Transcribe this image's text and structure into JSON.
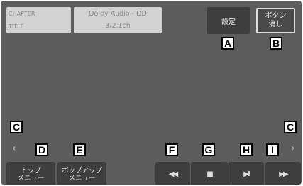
{
  "info": {
    "chapter_label": "CHAPTER",
    "title_label": "TITLE",
    "audio_format": "Dolby Audio - DD",
    "channels": "3/2.1ch"
  },
  "buttons": {
    "settings": "設定",
    "clear_line1": "ボタン",
    "clear_line2": "消し",
    "top_menu_line1": "トップ",
    "top_menu_line2": "メニュー",
    "popup_menu_line1": "ポップアップ",
    "popup_menu_line2": "メニュー",
    "rewind": "◀◀",
    "stop": "■",
    "play_pause": "▶II",
    "fast_forward": "▶▶"
  },
  "nav": {
    "prev": "‹",
    "next": "›"
  },
  "callouts": {
    "a": "A",
    "b": "B",
    "c_left": "C",
    "c_right": "C",
    "d": "D",
    "e": "E",
    "f": "F",
    "g": "G",
    "h": "H",
    "i": "I"
  }
}
